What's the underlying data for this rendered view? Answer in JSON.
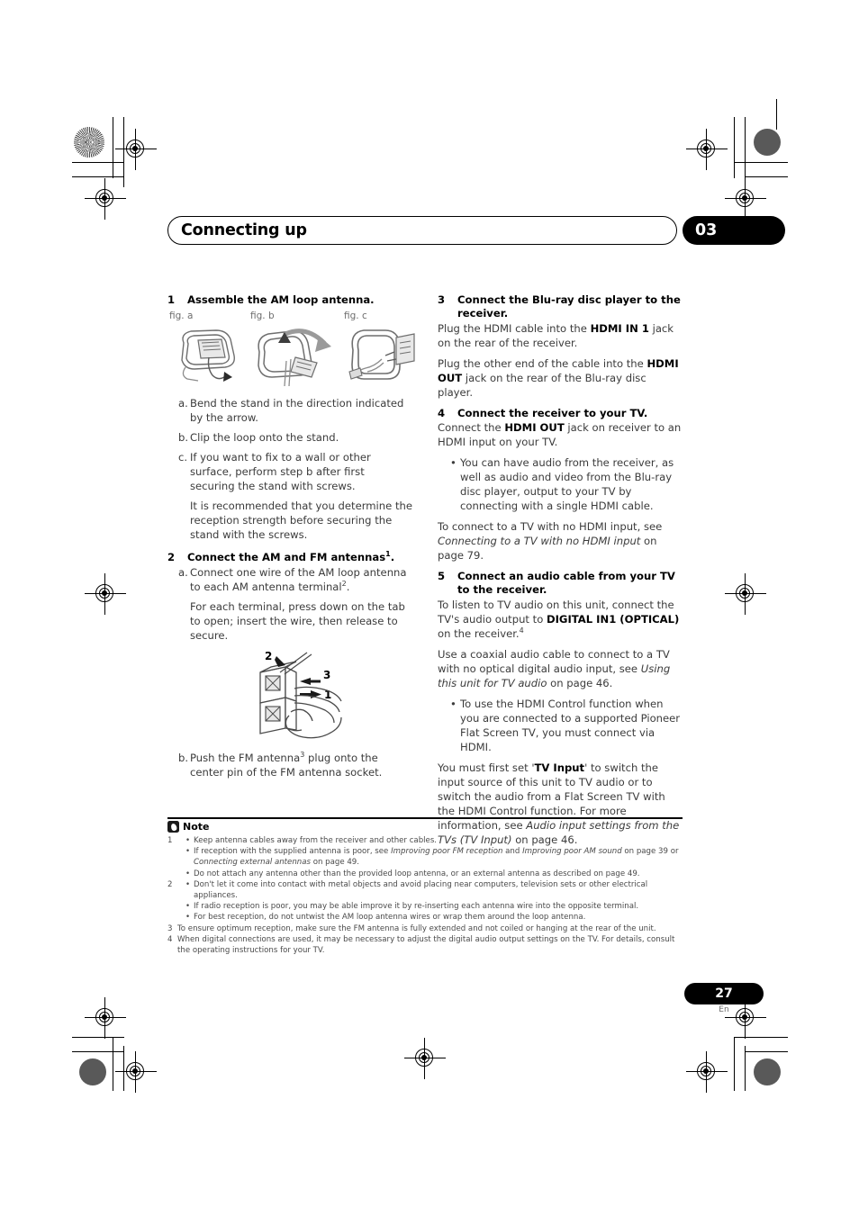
{
  "header": {
    "chapter_title": "Connecting up",
    "chapter_number": "03"
  },
  "page_footer": {
    "page_number": "27",
    "language_code": "En"
  },
  "left_column": {
    "step1": {
      "number": "1",
      "title": "Assemble the AM loop antenna.",
      "figures": [
        {
          "label": "fig. a",
          "name": "am-loop-antenna-fig-a"
        },
        {
          "label": "fig. b",
          "name": "am-loop-antenna-fig-b"
        },
        {
          "label": "fig. c",
          "name": "am-loop-antenna-fig-c"
        }
      ],
      "items": [
        {
          "label": "a.",
          "text": "Bend the stand in the direction indicated by the arrow."
        },
        {
          "label": "b.",
          "text": "Clip the loop onto the stand."
        },
        {
          "label": "c.",
          "text": "If you want to fix to a wall or other surface, perform step b after first securing the stand with screws."
        }
      ],
      "item_c_note": "It is recommended that you determine the reception strength before securing the stand with the screws."
    },
    "step2": {
      "number": "2",
      "title_before": "Connect the AM and FM antennas",
      "title_sup": "1",
      "title_after": ".",
      "item_a_label": "a.",
      "item_a_before": "Connect one wire of the AM loop antenna to each AM antenna terminal",
      "item_a_sup": "2",
      "item_a_after": ".",
      "item_a_note": "For each terminal, press down on the tab to open; insert the wire, then release to secure.",
      "terminal_figure_callouts": [
        "1",
        "2",
        "3"
      ],
      "item_b_label": "b.",
      "item_b_before": "Push the FM antenna",
      "item_b_sup": "3",
      "item_b_after": " plug onto the center pin of the FM antenna socket."
    }
  },
  "right_column": {
    "step3": {
      "number": "3",
      "title": "Connect the Blu-ray disc player to the receiver.",
      "p1_a": "Plug the HDMI cable into the ",
      "p1_b": "HDMI IN 1",
      "p1_c": " jack on the rear of the receiver.",
      "p2_a": "Plug the other end of the cable into the ",
      "p2_b": "HDMI OUT",
      "p2_c": " jack on the rear of the Blu-ray disc player."
    },
    "step4": {
      "number": "4",
      "title": "Connect the receiver to your TV.",
      "p1_a": "Connect the ",
      "p1_b": "HDMI OUT",
      "p1_c": " jack on receiver to an HDMI input on your TV.",
      "bullet1": "You can have audio from the receiver, as well as audio and video from the Blu-ray disc player, output to your TV by connecting with a single HDMI cable.",
      "p2_a": "To connect to a TV with no HDMI input, see ",
      "p2_italic": "Connecting to a TV with no HDMI input",
      "p2_c": " on page 79."
    },
    "step5": {
      "number": "5",
      "title": "Connect an audio cable from your TV to the receiver.",
      "p1_a": "To listen to TV audio on this unit, connect the TV's audio output to ",
      "p1_b": "DIGITAL IN1 (OPTICAL)",
      "p1_c": " on the receiver.",
      "p1_sup": "4",
      "p2_a": "Use a coaxial audio cable to connect to a TV with no optical digital audio input, see ",
      "p2_italic": "Using this unit for TV audio",
      "p2_c": " on page 46.",
      "bullet1": "To use the HDMI Control function when you are connected to a supported Pioneer Flat Screen TV, you must connect via HDMI.",
      "p3_a": "You must first set '",
      "p3_b": "TV Input",
      "p3_c": "' to switch the input source of this unit to TV audio or to switch the audio from a Flat Screen TV with the HDMI Control function. For more information, see ",
      "p3_italic": "Audio input settings from the TVs (TV Input)",
      "p3_e": " on page 46."
    }
  },
  "notes": {
    "label": "Note",
    "items": [
      {
        "number": "1",
        "lines": [
          {
            "type": "bullet",
            "text": "Keep antenna cables away from the receiver and other cables."
          },
          {
            "type": "bullet_rich",
            "a": "If reception with the supplied antenna is poor, see ",
            "i1": "Improving poor FM reception",
            "b": " and ",
            "i2": "Improving poor AM sound",
            "c": " on page 39 or ",
            "i3": "Connecting external antennas",
            "d": " on page 49."
          },
          {
            "type": "bullet",
            "text": "Do not attach any antenna other than the provided loop antenna, or an external antenna as described on page 49."
          }
        ]
      },
      {
        "number": "2",
        "lines": [
          {
            "type": "bullet",
            "text": "Don't let it come into contact with metal objects and avoid placing near computers, television sets or other electrical appliances."
          },
          {
            "type": "bullet",
            "text": "If radio reception is poor, you may be able improve it by re-inserting each antenna wire into the opposite terminal."
          },
          {
            "type": "bullet",
            "text": "For best reception, do not untwist the AM loop antenna wires or wrap them around the loop antenna."
          }
        ]
      },
      {
        "number": "3",
        "lines": [
          {
            "type": "plain",
            "text": "To ensure optimum reception, make sure the FM antenna is fully extended and not coiled or hanging at the rear of the unit."
          }
        ]
      },
      {
        "number": "4",
        "lines": [
          {
            "type": "plain",
            "text": "When digital connections are used, it may be necessary to adjust the digital audio output settings on the TV. For details, consult the operating instructions for your TV."
          }
        ]
      }
    ]
  },
  "colors": {
    "text": "#3b3b3b",
    "heading": "#000000",
    "muted": "#6d6d6d",
    "badge_bg": "#000000"
  }
}
